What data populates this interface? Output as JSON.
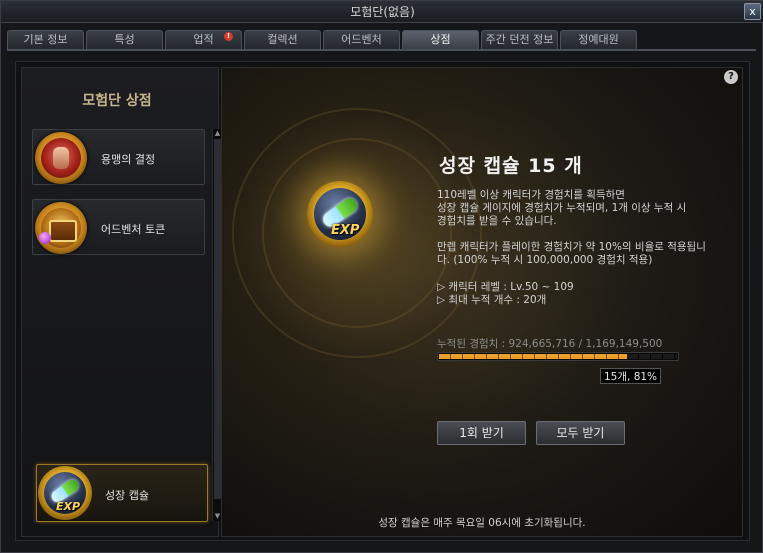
{
  "window": {
    "title": "모험단(없음)",
    "close_label": "x"
  },
  "tabs": [
    {
      "label": "기본 정보",
      "active": false,
      "alert": false
    },
    {
      "label": "특성",
      "active": false,
      "alert": false
    },
    {
      "label": "업적",
      "active": false,
      "alert": true
    },
    {
      "label": "컬렉션",
      "active": false,
      "alert": false
    },
    {
      "label": "어드벤처",
      "active": false,
      "alert": false
    },
    {
      "label": "상점",
      "active": true,
      "alert": false
    },
    {
      "label": "주간 던전 정보",
      "active": false,
      "alert": false
    },
    {
      "label": "정예대원",
      "active": false,
      "alert": false
    }
  ],
  "alert_badge": "!",
  "left": {
    "title": "모험단 상점",
    "items": [
      {
        "label": "용맹의 결정",
        "icon": "fist-icon"
      },
      {
        "label": "어드벤처 토큰",
        "icon": "treasure-chest-icon"
      }
    ],
    "selected": {
      "label": "성장 캡슐",
      "icon": "exp-capsule-icon",
      "icon_text": "EXP"
    }
  },
  "main": {
    "help": "?",
    "icon_text": "EXP",
    "title": "성장 캡슐 15 개",
    "desc1": [
      "110레벨 이상 캐릭터가 경험치를 획득하면",
      "성장 캡슐 게이지에 경험치가 누적되며, 1개 이상 누적 시",
      "경험치를 받을 수 있습니다."
    ],
    "desc2": [
      "만렙 캐릭터가 플레이한 경험치가 약 10%의 비율로 적용됩니",
      "다. (100% 누적 시 100,000,000 경험치 적용)"
    ],
    "desc3": [
      "▷ 캐릭터 레벨 : Lv.50 ~ 109",
      "▷ 최대 누적 개수 : 20개"
    ],
    "progress": {
      "label": "누적된 경험치 : 924,665,716 / 1,169,149,500",
      "fraction": 0.79,
      "tag": "15개, 81%"
    },
    "buttons": {
      "receive_one": "1회 받기",
      "receive_all": "모두 받기"
    },
    "footer": "성장 캡슐은 매주 목요일 06시에 초기화됩니다."
  }
}
